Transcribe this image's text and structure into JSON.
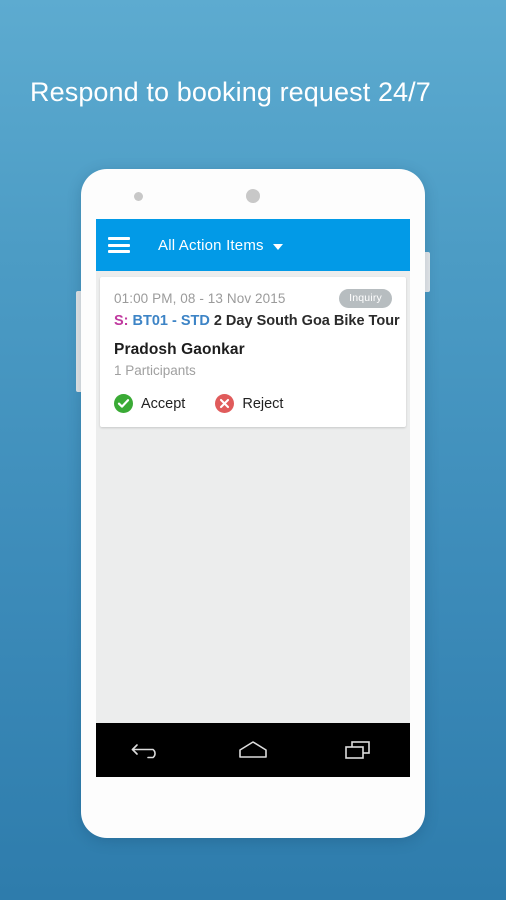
{
  "headline": "Respond to booking request 24/7",
  "colors": {
    "background_top": "#5dabd0",
    "background_bottom": "#2e7cac",
    "appbar": "#029ae7",
    "accept": "#3aaa35",
    "reject": "#e05b5b",
    "badge": "#b7bdc0",
    "code_blue": "#3d84c6",
    "prefix_magenta": "#c0399f",
    "screen_background": "#eceded"
  },
  "appbar": {
    "menu_icon": "hamburger-icon",
    "title": "All Action Items",
    "caret_icon": "chevron-down-icon"
  },
  "card": {
    "date": "01:00 PM, 08 - 13 Nov 2015",
    "badge": "Inquiry",
    "service_prefix": "S:",
    "service_code": "BT01 - STD",
    "service_title": "2 Day South Goa Bike Tour",
    "customer_name": "Pradosh Gaonkar",
    "participants": "1 Participants",
    "accept_label": "Accept",
    "accept_icon": "check-circle-icon",
    "reject_label": "Reject",
    "reject_icon": "close-circle-icon"
  },
  "navbar": {
    "back_icon": "back-arrow-icon",
    "home_icon": "home-icon",
    "recents_icon": "recents-icon"
  }
}
